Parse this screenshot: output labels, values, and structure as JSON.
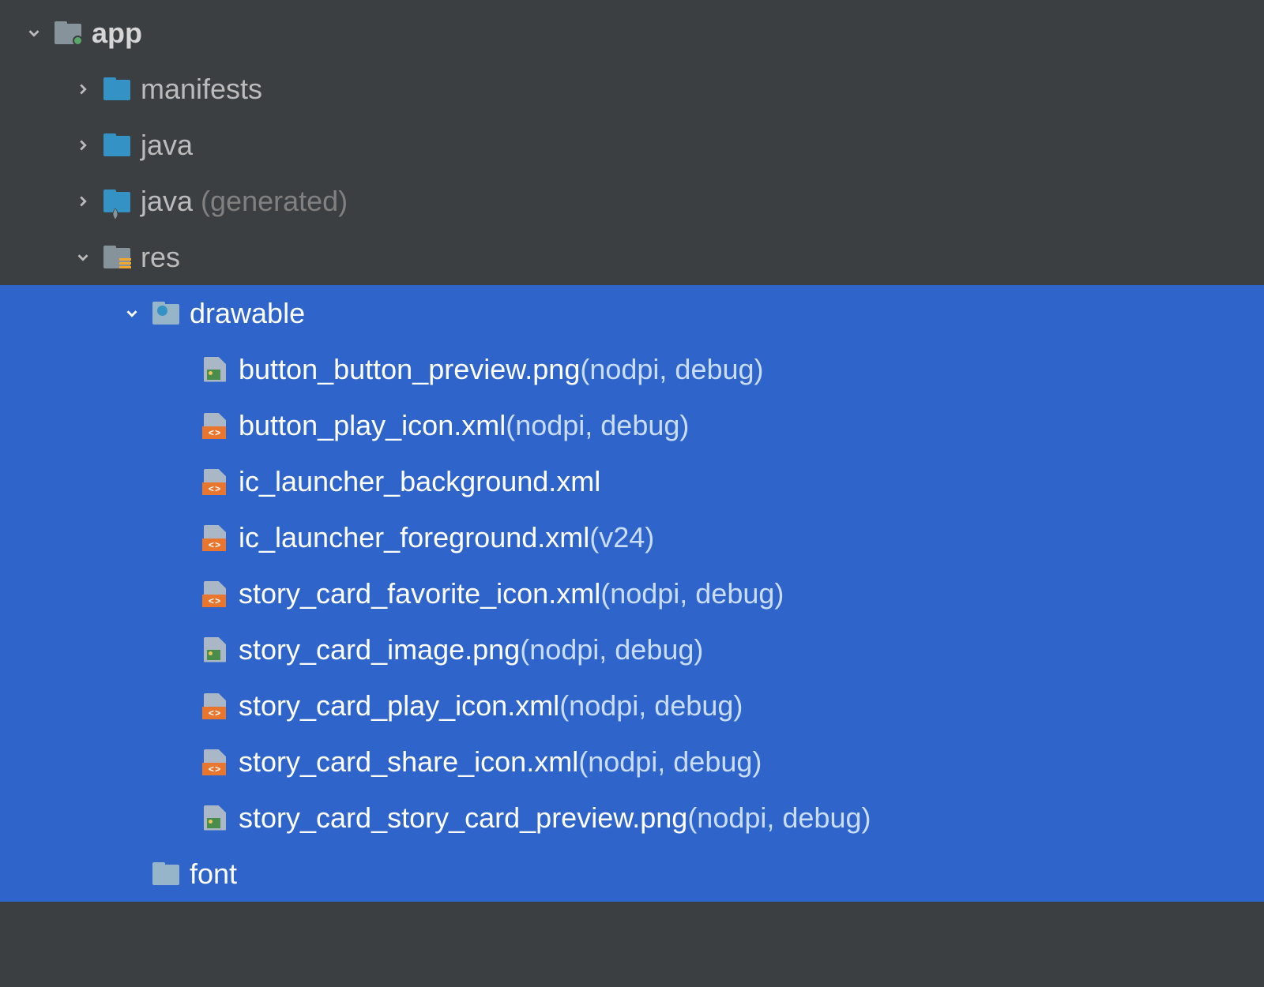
{
  "tree": {
    "app": {
      "label": "app"
    },
    "manifests": {
      "label": "manifests"
    },
    "java": {
      "label": "java"
    },
    "java_gen": {
      "label": "java",
      "suffix": "(generated)"
    },
    "res": {
      "label": "res"
    },
    "drawable": {
      "label": "drawable"
    },
    "font": {
      "label": "font"
    },
    "files": [
      {
        "name": "button_button_preview.png",
        "suffix": "(nodpi, debug)",
        "type": "png"
      },
      {
        "name": "button_play_icon.xml",
        "suffix": "(nodpi, debug)",
        "type": "xml"
      },
      {
        "name": "ic_launcher_background.xml",
        "suffix": "",
        "type": "xml"
      },
      {
        "name": "ic_launcher_foreground.xml",
        "suffix": "(v24)",
        "type": "xml"
      },
      {
        "name": "story_card_favorite_icon.xml",
        "suffix": "(nodpi, debug)",
        "type": "xml"
      },
      {
        "name": "story_card_image.png",
        "suffix": "(nodpi, debug)",
        "type": "png"
      },
      {
        "name": "story_card_play_icon.xml",
        "suffix": "(nodpi, debug)",
        "type": "xml"
      },
      {
        "name": "story_card_share_icon.xml",
        "suffix": "(nodpi, debug)",
        "type": "xml"
      },
      {
        "name": "story_card_story_card_preview.png",
        "suffix": "(nodpi, debug)",
        "type": "png"
      }
    ]
  }
}
